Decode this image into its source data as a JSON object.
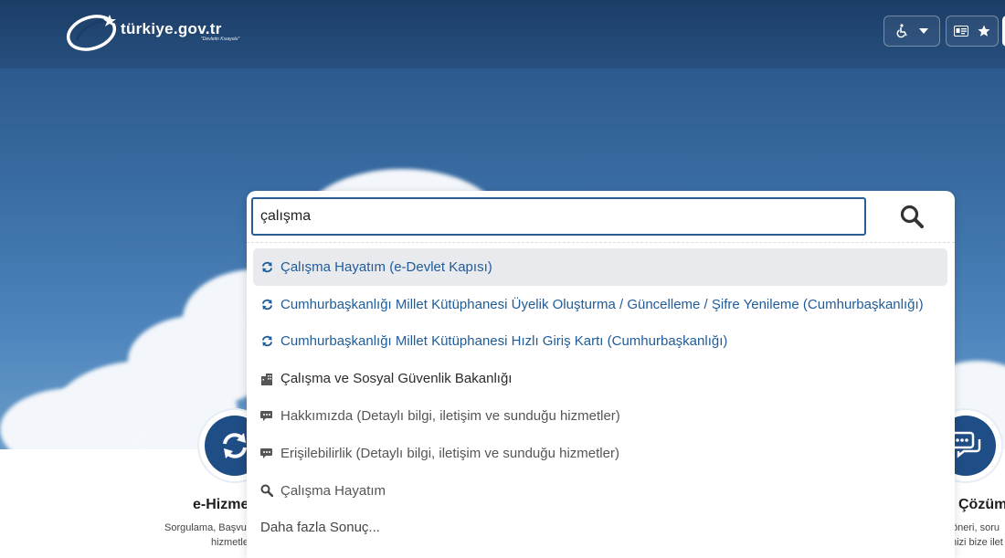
{
  "header": {
    "logo_text": "türkiye.gov.tr",
    "logo_tagline": "\"Devletin Kısayolu\"",
    "accessibility_icon": "wheelchair-icon",
    "id_card_icon": "id-card-icon",
    "favorites_icon": "star-icon"
  },
  "search": {
    "value": "çalışma",
    "button_icon": "search-icon"
  },
  "results": [
    {
      "icon": "refresh-icon",
      "label": "Çalışma Hayatım (e-Devlet Kapısı)",
      "type": "link"
    },
    {
      "icon": "refresh-icon",
      "label": "Cumhurbaşkanlığı Millet Kütüphanesi Üyelik Oluşturma / Güncelleme / Şifre Yenileme (Cumhurbaşkanlığı)",
      "type": "link"
    },
    {
      "icon": "refresh-icon",
      "label": "Cumhurbaşkanlığı Millet Kütüphanesi Hızlı Giriş Kartı (Cumhurbaşkanlığı)",
      "type": "link"
    },
    {
      "icon": "building-icon",
      "label": "Çalışma ve Sosyal Güvenlik Bakanlığı",
      "type": "org"
    },
    {
      "icon": "chat-icon",
      "label": "Hakkımızda (Detaylı bilgi, iletişim ve sunduğu hizmetler)",
      "type": "info"
    },
    {
      "icon": "chat-icon",
      "label": "Erişilebilirlik (Detaylı bilgi, iletişim ve sunduğu hizmetler)",
      "type": "info"
    },
    {
      "icon": "search-icon",
      "label": "Çalışma Hayatım",
      "type": "info"
    }
  ],
  "more_results": "Daha fazla Sonuç...",
  "sections": {
    "left": {
      "title": "e-Hizme",
      "desc_line1": "Sorgulama, Başvu",
      "desc_line2": "hizmetle"
    },
    "right": {
      "title": "Çözüm",
      "desc_line1": "öneri, soru",
      "desc_line2": "nizi bize ilet"
    }
  },
  "colors": {
    "header": "#1c3d66",
    "accent": "#2a5d94",
    "link": "#1f5c9a",
    "icon_circle": "#1f4d85"
  }
}
